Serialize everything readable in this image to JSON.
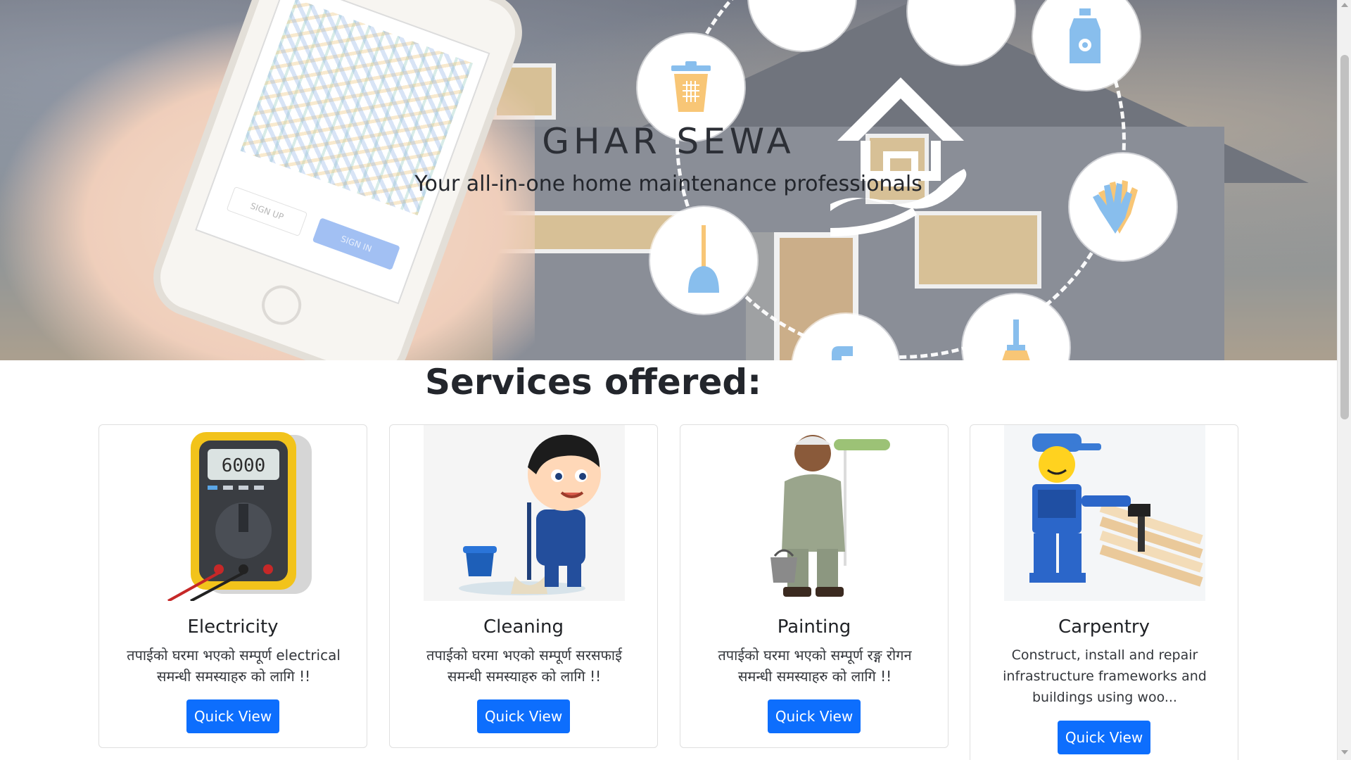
{
  "hero": {
    "title": "GHAR SEWA",
    "subtitle": "Your all-in-one home maintenance professionals",
    "phone": {
      "signup_label": "SIGN UP",
      "signin_label": "SIGN IN"
    }
  },
  "services": {
    "heading": "Services offered:",
    "cards": [
      {
        "title": "Electricity",
        "description": "तपाईको घरमा भएको सम्पूर्ण electrical समन्धी समस्याहरु को लागि !!",
        "button": "Quick View",
        "meter_reading": "6000"
      },
      {
        "title": "Cleaning",
        "description": "तपाईको घरमा भएको सम्पूर्ण सरसफाई समन्धी समस्याहरु को लागि !!",
        "button": "Quick View"
      },
      {
        "title": "Painting",
        "description": "तपाईको घरमा भएको सम्पूर्ण रङ्ग रोगन समन्धी समस्याहरु को लागि !!",
        "button": "Quick View"
      },
      {
        "title": "Carpentry",
        "description": "Construct, install and repair infrastructure frameworks and buildings using woo...",
        "button": "Quick View"
      }
    ]
  },
  "colors": {
    "primary_button": "#0d6efd",
    "icon_blue": "#5aa6e6",
    "icon_orange": "#f5b042"
  },
  "icons": [
    "trash-bin-icon",
    "detergent-bottle-icon",
    "gloves-icon",
    "plunger-icon",
    "broom-icon",
    "spray-icon",
    "house-hand-icon"
  ]
}
